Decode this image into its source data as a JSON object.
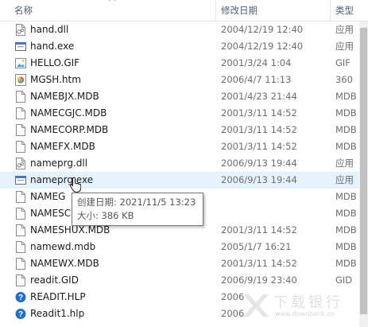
{
  "columns": {
    "name": "名称",
    "date": "修改日期",
    "type": "类型"
  },
  "files": [
    {
      "name": "hand.dll",
      "date": "2004/12/19 12:40",
      "type": "应用",
      "icon": "dll-icon"
    },
    {
      "name": "hand.exe",
      "date": "2004/12/19 12:40",
      "type": "应用",
      "icon": "exe-icon"
    },
    {
      "name": "HELLO.GIF",
      "date": "2001/3/24 1:04",
      "type": "GIF",
      "icon": "image-icon"
    },
    {
      "name": "MGSH.htm",
      "date": "2006/4/7 11:13",
      "type": "360",
      "icon": "browser-icon"
    },
    {
      "name": "NAMEBJX.MDB",
      "date": "2001/4/23 21:44",
      "type": "MDB",
      "icon": "file-icon"
    },
    {
      "name": "NAMECGJC.MDB",
      "date": "2001/3/11 14:52",
      "type": "MDB",
      "icon": "file-icon"
    },
    {
      "name": "NAMECORP.MDB",
      "date": "2001/3/11 14:52",
      "type": "MDB",
      "icon": "file-icon"
    },
    {
      "name": "NAMEFX.MDB",
      "date": "2001/3/11 14:52",
      "type": "MDB",
      "icon": "file-icon"
    },
    {
      "name": "nameprg.dll",
      "date": "2006/9/13 19:44",
      "type": "应用",
      "icon": "dll-icon"
    },
    {
      "name": "nameprg.exe",
      "date": "2006/9/13 19:44",
      "type": "应用",
      "icon": "exe-icon"
    },
    {
      "name": "NAMEG",
      "date": "",
      "type": "MDB",
      "icon": "file-icon"
    },
    {
      "name": "NAMESC",
      "date": "",
      "type": "MDB",
      "icon": "file-icon"
    },
    {
      "name": "NAMESHUX.MDB",
      "date": "2001/3/11 14:52",
      "type": "MDB",
      "icon": "file-icon"
    },
    {
      "name": "namewd.mdb",
      "date": "2005/1/7 16:21",
      "type": "MDB",
      "icon": "file-icon"
    },
    {
      "name": "NAMEWX.MDB",
      "date": "2001/3/11 14:52",
      "type": "MDB",
      "icon": "file-icon"
    },
    {
      "name": "readit.GID",
      "date": "2006/9/19 23:40",
      "type": "GID",
      "icon": "file-icon"
    },
    {
      "name": "READIT.HLP",
      "date": "2006",
      "type": "",
      "icon": "help-icon"
    },
    {
      "name": "Readit1.hlp",
      "date": "2006",
      "type": "",
      "icon": "help-icon"
    }
  ],
  "tooltip": {
    "created": "创建日期: 2021/11/5 13:23",
    "size": "大小: 386 KB"
  },
  "watermark": {
    "title": "下载银行",
    "url": "www.downbank.cn"
  },
  "colors": {
    "highlight": "#e5f3ff",
    "header_text": "#4c607a",
    "help_blue": "#1e6fd0"
  }
}
